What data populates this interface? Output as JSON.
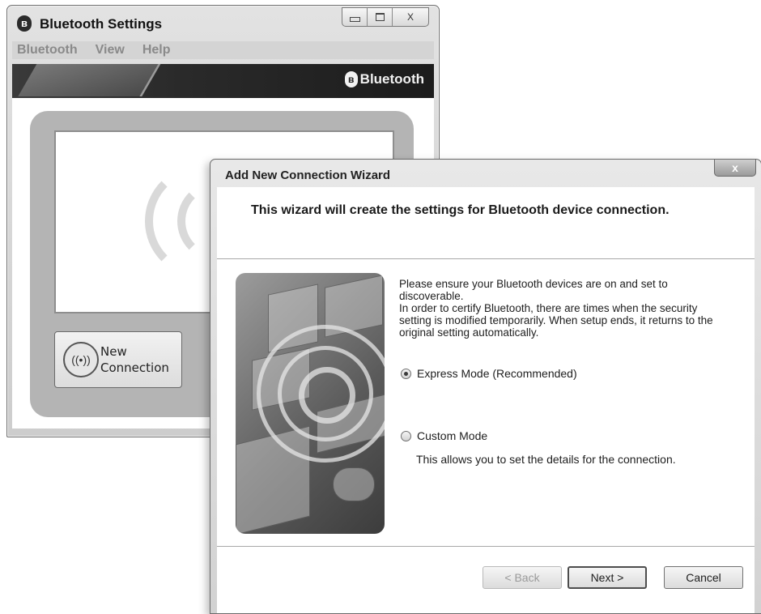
{
  "bt_window": {
    "title": "Bluetooth Settings",
    "caption_close_glyph": "X",
    "menu": [
      "Bluetooth",
      "View",
      "Help"
    ],
    "banner_logo": "Bluetooth",
    "new_connection_button": {
      "line1": "New",
      "line2": "Connection"
    }
  },
  "wizard": {
    "title": "Add New Connection Wizard",
    "close_glyph": "x",
    "heading": "This wizard will create the settings for Bluetooth device connection.",
    "description_line1": "Please ensure your Bluetooth devices are on and set to discoverable.",
    "description_line2": "In order to certify Bluetooth, there are times when the security setting is modified temporarily. When setup ends, it returns to the original setting automatically.",
    "express_mode_label": "Express Mode (Recommended)",
    "express_mode_checked": true,
    "custom_mode_label": "Custom Mode",
    "custom_mode_checked": false,
    "custom_mode_description": "This allows you to set the details for the connection.",
    "buttons": {
      "back": "< Back",
      "next": "Next >",
      "cancel": "Cancel"
    }
  }
}
